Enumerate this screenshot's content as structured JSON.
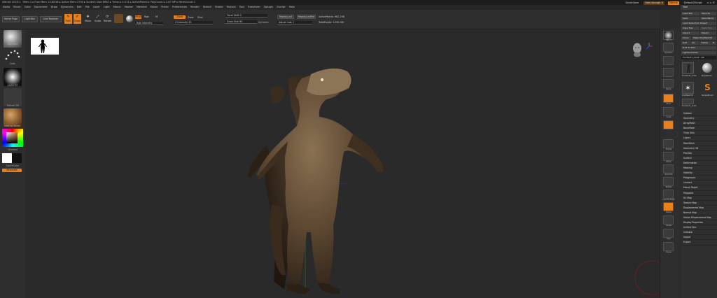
{
  "titlebar": {
    "title": "ZBrush 2025.1  ·  Mem 1   ▸ Free Mem 13.82GB ▸ Active Mem 2793 ▸ Scratch Disk 8962 ▸ Timer ▸ 0.011 ▸ ActivePoints ▸ PolyCount ▸ 2.67 MP ▸ MeshCount 2",
    "quicksave": "QuickSave",
    "see_through": "See-through  0",
    "menus": "Menus",
    "default_script": "DefaultZScript"
  },
  "menubar": [
    "Alpha",
    "Brush",
    "Color",
    "Document",
    "Draw",
    "Dynamics",
    "Edit",
    "File",
    "Layer",
    "Light",
    "Macro",
    "Marker",
    "Material",
    "Movie",
    "Picker",
    "Preferences",
    "Render",
    "Stencil",
    "Stroke",
    "Texture",
    "Tool",
    "Transform",
    "Zplugin",
    "Zscript",
    "Help"
  ],
  "shelf": {
    "home_page": "Home Page",
    "lightbox": "LightBox",
    "live_boolean": "Live Boolean",
    "edit": "Edit",
    "draw": "Draw",
    "move": "Move",
    "scale": "Scale",
    "rotate": "Rotate",
    "mrgb": "Mrgb",
    "rgb": "Rgb",
    "m": "M",
    "zadd": "Zadd",
    "zsub": "Zsub",
    "zcut": "Zcut",
    "rgb_intensity": "Rgb Intensity",
    "z_intensity": "Z Intensity 25",
    "focal_shift": "Focal Shift 0",
    "draw_size": "Draw Size 64",
    "dynamic": "Dynamic",
    "replay_last": "ReplayLast",
    "replay_last_rel": "ReplayLastRel",
    "adjust_last": "Adjust Last 1",
    "active_points": "ActivePoints: 962,298",
    "total_points": "TotalPoints: 1.991 Mil"
  },
  "left_tray": {
    "brush": "Standard",
    "stroke": "Dots",
    "alpha": "Alpha Off",
    "texture": "Texture Off",
    "material": "MatCap Brown",
    "gradient": "Gradient",
    "switch_color": "SwitchColor",
    "alternate": "Alternate"
  },
  "right_shelf": [
    "SPix 3",
    "Dynamic",
    "Persp",
    "Floor",
    "Local",
    "Frame",
    "Move",
    "Zoom3D",
    "Rotate",
    "Line Fill PolyF",
    "Transp",
    "Ghost",
    "Solo",
    "Xpose"
  ],
  "tool_panel": {
    "header": "Tool",
    "load_tool": "Load Tool",
    "save_as": "Save As",
    "save": "Save",
    "save_name": "Save Name",
    "load_from_project": "Load Tools From Project",
    "copy_tool": "Copy Tool",
    "paste_tool": "Paste Tool",
    "import": "Import",
    "export": "Export",
    "clone": "Clone",
    "make_polymesh": "Make PolyMesh3D",
    "goz": "GoZ",
    "all": "All",
    "visible": "Visible",
    "r": "R",
    "goz_to_rhino": "GoZ To iPad",
    "lightbox_tools": "Lightbox▸Tools",
    "current_tool": "Formbot7_Low2 . 48",
    "thumbs": [
      "Formbot7_Low2",
      "PolySphere",
      "Formbot7_Low2",
      "SimpleBrush",
      "PolyMesh3D",
      "Formbot7_Low2"
    ],
    "sections": [
      "Subtool",
      "Geometry",
      "ArrayMesh",
      "NanoMesh",
      "Thick Skin",
      "Layers",
      "FiberMesh",
      "Geometry HD",
      "Preview",
      "Surface",
      "Deformation",
      "Masking",
      "Visibility",
      "Polygroups",
      "Contact",
      "Morph Target",
      "Polypaint",
      "UV Map",
      "Texture Map",
      "Displacement Map",
      "Normal Map",
      "Vector Displacement Map",
      "Display Properties",
      "Unified Skin",
      "Initialize",
      "Import",
      "Export"
    ]
  },
  "colors": {
    "accent": "#e8801c",
    "bg": "#2b2b2b",
    "panel": "#2f2f2f"
  }
}
